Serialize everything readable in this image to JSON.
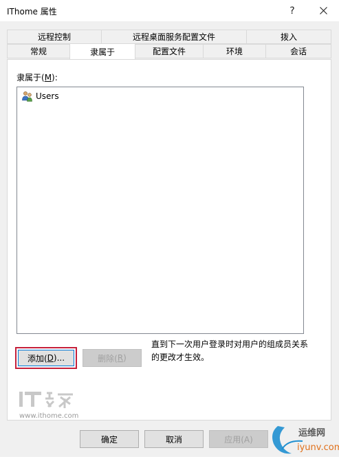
{
  "window": {
    "title": "IThome 属性",
    "help_glyph": "?",
    "close_glyph": "✕"
  },
  "tabs_row1": [
    "远程控制",
    "远程桌面服务配置文件",
    "拨入"
  ],
  "tabs_row2": [
    "常规",
    "隶属于",
    "配置文件",
    "环境",
    "会话"
  ],
  "active_tab": "隶属于",
  "member_of": {
    "label_prefix": "隶属于(",
    "label_key": "M",
    "label_suffix": "):",
    "items": [
      "Users"
    ]
  },
  "buttons": {
    "add": {
      "prefix": "添加(",
      "key": "D",
      "suffix": ")..."
    },
    "remove": {
      "prefix": "删除(",
      "key": "R",
      "suffix": ")"
    }
  },
  "note": "直到下一次用户登录时对用户的组成员关系的更改才生效。",
  "footer": {
    "ok": "确定",
    "cancel": "取消",
    "apply": "应用(A)"
  },
  "watermark": {
    "logo_text": "IT之家",
    "url": "www.ithome.com"
  },
  "corner_watermark": {
    "line1": "运维网",
    "line2": "iyunv.com"
  },
  "colors": {
    "highlight": "#c41f3a",
    "focus_border": "#0078d7"
  }
}
